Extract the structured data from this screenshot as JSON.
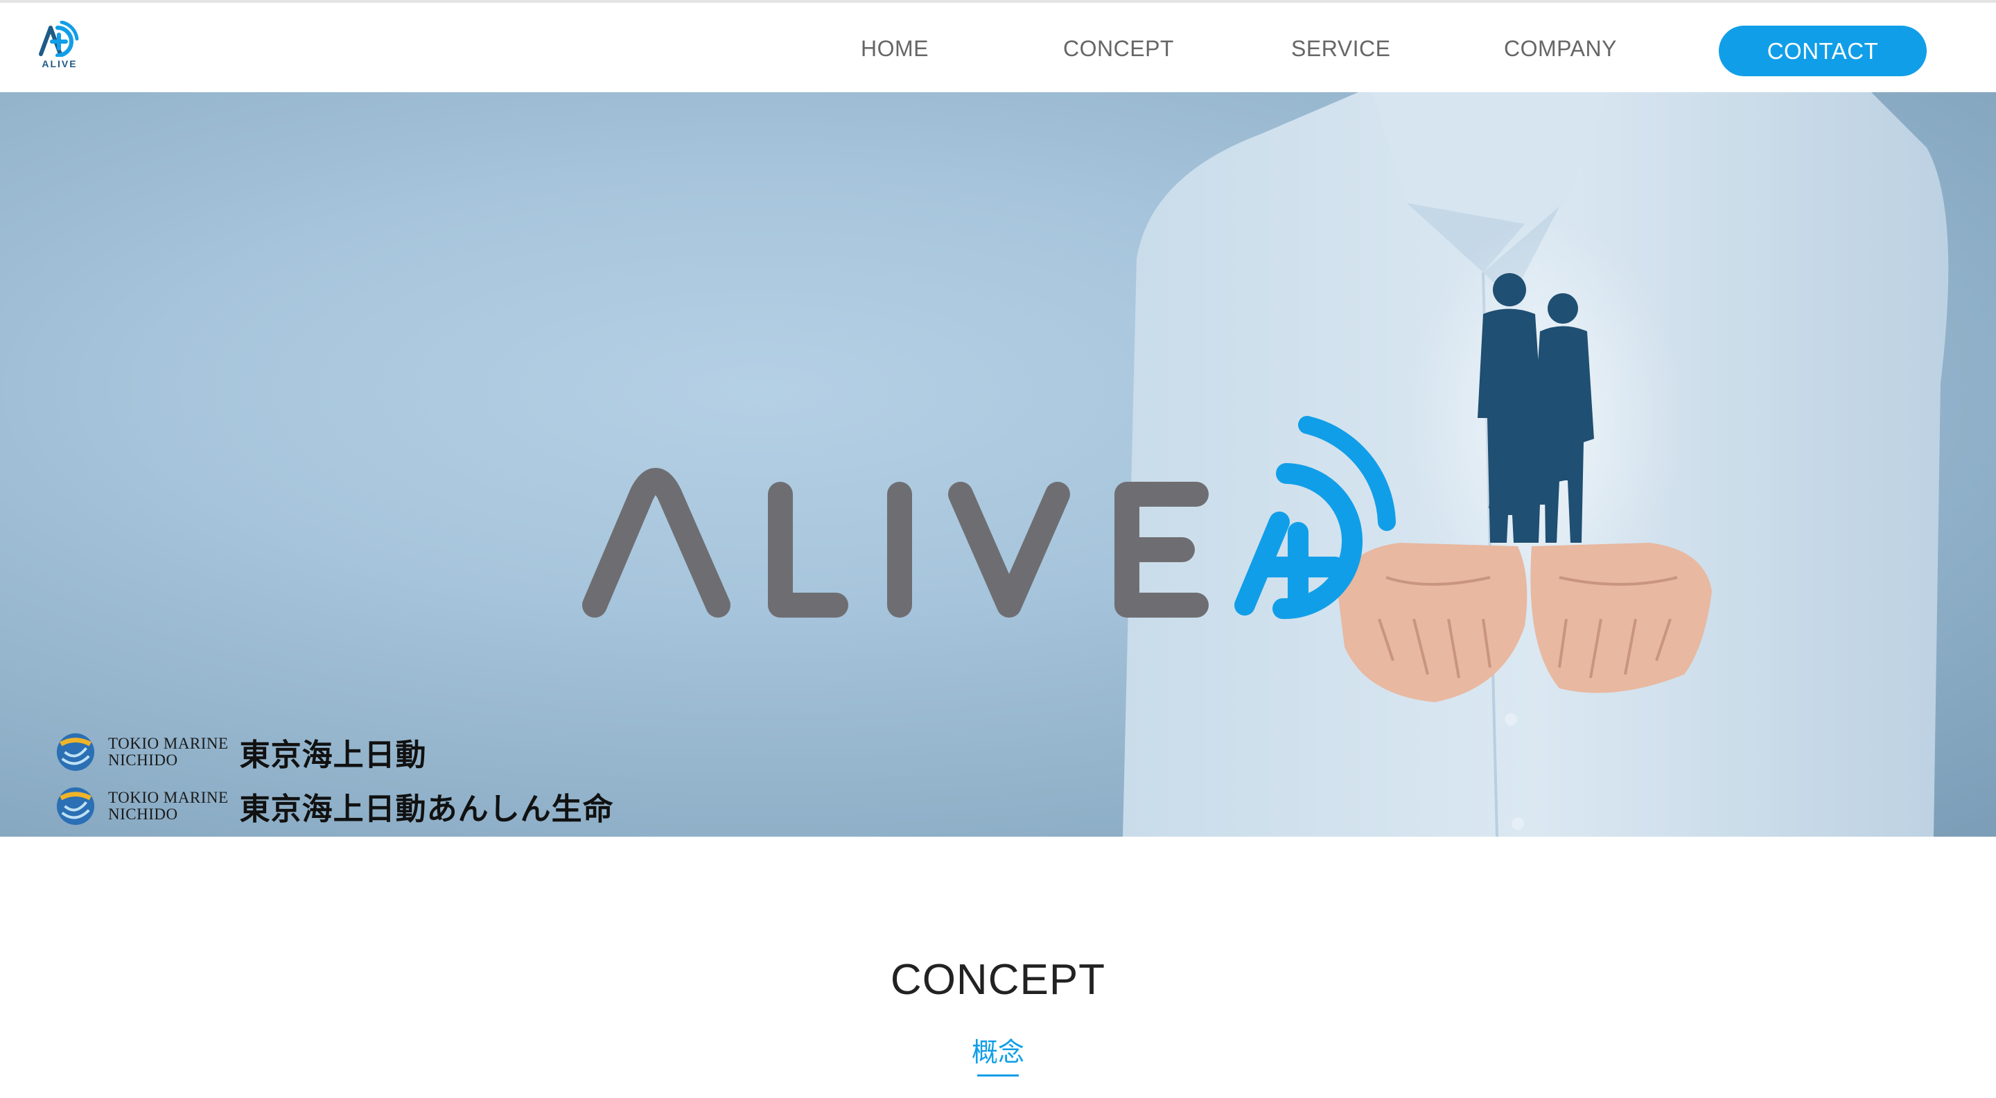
{
  "header": {
    "logo_text": "ALIVE",
    "nav": {
      "home": "HOME",
      "concept": "CONCEPT",
      "service": "SERVICE",
      "company": "COMPANY",
      "contact": "CONTACT"
    }
  },
  "hero": {
    "brand_wordmark": "ALIVE",
    "sponsors": [
      {
        "en_line1": "TOKIO MARINE",
        "en_line2": "NICHIDO",
        "jp": "東京海上日動"
      },
      {
        "en_line1": "TOKIO MARINE",
        "en_line2": "NICHIDO",
        "jp": "東京海上日動あんしん生命"
      }
    ]
  },
  "section": {
    "title": "CONCEPT",
    "subtitle": "概念"
  },
  "colors": {
    "accent": "#119ee8",
    "wordmark_gray": "#6e6e72",
    "nav_text": "#666666",
    "family_silhouette": "#1f4f72"
  }
}
